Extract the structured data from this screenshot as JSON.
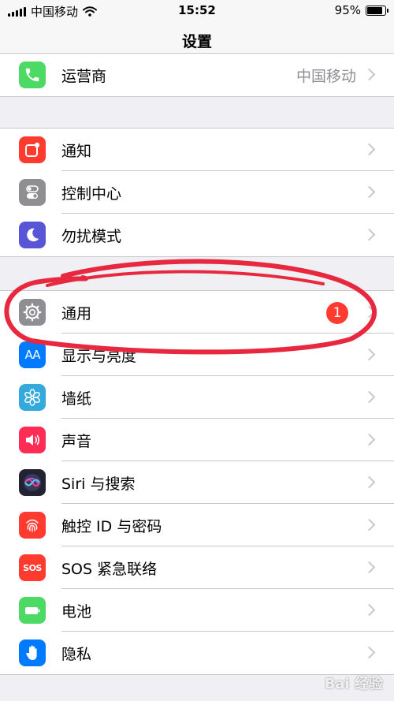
{
  "status_bar": {
    "carrier": "中国移动",
    "time": "15:52",
    "battery": "95%",
    "battery_level": 0.95
  },
  "nav": {
    "title": "设置"
  },
  "group0": {
    "items": [
      {
        "label": "运营商",
        "value": "中国移动",
        "icon": "phone-icon",
        "color": "#4cd964"
      }
    ]
  },
  "group1": {
    "items": [
      {
        "label": "通知",
        "icon": "notification-icon",
        "color": "#ff3b30"
      },
      {
        "label": "控制中心",
        "icon": "toggle-icon",
        "color": "#8e8e93"
      },
      {
        "label": "勿扰模式",
        "icon": "moon-icon",
        "color": "#5856d6"
      }
    ]
  },
  "group2": {
    "items": [
      {
        "label": "通用",
        "badge": "1",
        "icon": "gear-icon",
        "color": "#8e8e93"
      },
      {
        "label": "显示与亮度",
        "icon": "text-size-icon",
        "glyph": "AA",
        "color": "#007aff"
      },
      {
        "label": "墙纸",
        "icon": "flower-icon",
        "color": "#34aadc"
      },
      {
        "label": "声音",
        "icon": "speaker-icon",
        "color": "#ff2d55"
      },
      {
        "label": "Siri 与搜索",
        "icon": "siri-icon",
        "color": "#222233"
      },
      {
        "label": "触控 ID 与密码",
        "icon": "fingerprint-icon",
        "color": "#ff3b30"
      },
      {
        "label": "SOS 紧急联络",
        "icon": "sos-icon",
        "glyph": "SOS",
        "color": "#ff3b30"
      },
      {
        "label": "电池",
        "icon": "battery-icon",
        "color": "#4cd964"
      },
      {
        "label": "隐私",
        "icon": "hand-icon",
        "color": "#007aff"
      }
    ]
  },
  "watermark": {
    "text": "Bai 经验"
  },
  "colors": {
    "annotation": "#e8283e",
    "badge": "#ff3b30",
    "background": "#efeff4"
  }
}
